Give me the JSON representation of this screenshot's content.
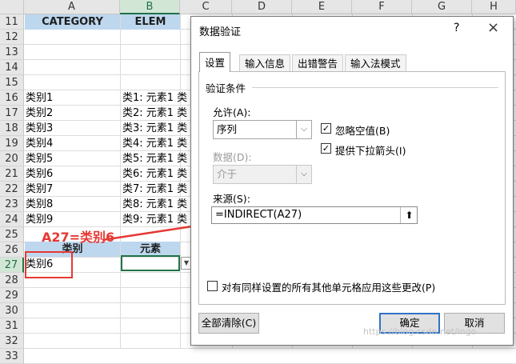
{
  "sheet": {
    "columns": [
      "A",
      "B",
      "C",
      "D",
      "E",
      "F",
      "G",
      "H"
    ],
    "selected_column": "B",
    "rows": [
      "11",
      "12",
      "13",
      "14",
      "15",
      "16",
      "17",
      "18",
      "19",
      "20",
      "21",
      "22",
      "23",
      "24",
      "25",
      "26",
      "27",
      "28",
      "29",
      "30",
      "31",
      "32",
      "33"
    ],
    "selected_row": "27",
    "header_row11": {
      "a": "CATEGORY",
      "b": "ELEM"
    },
    "categories": [
      "类别1",
      "类别2",
      "类别3",
      "类别4",
      "类别5",
      "类别6",
      "类别7",
      "类别8",
      "类别9"
    ],
    "elements": [
      "类1: 元素1 类",
      "类2: 元素1 类",
      "类3: 元素1 类",
      "类4: 元素1 类",
      "类5: 元素1 类",
      "类6: 元素1 类",
      "类7: 元素1 类",
      "类8: 元素1 类",
      "类9: 元素1 类"
    ],
    "header_row26": {
      "a": "类别",
      "b": "元素"
    },
    "a27": "类别6",
    "annotation": "A27=类别6",
    "highlight_color": "#bdd7ee",
    "annotation_color": "#e53935"
  },
  "dialog": {
    "title": "数据验证",
    "help": "?",
    "close": "×",
    "tabs": [
      "设置",
      "输入信息",
      "出错警告",
      "输入法模式"
    ],
    "section": "验证条件",
    "allow_label": "允许(A):",
    "allow_value": "序列",
    "ignore_blank": "忽略空值(B)",
    "dropdown_arrow": "提供下拉箭头(I)",
    "data_label": "数据(D):",
    "data_value": "介于",
    "source_label": "来源(S):",
    "source_value": "=INDIRECT(A27)",
    "apply_all": "对有同样设置的所有其他单元格应用这些更改(P)",
    "clear_all": "全部清除(C)",
    "ok": "确定",
    "cancel": "取消"
  },
  "watermark": "https://blog.csdn.net/lngo"
}
